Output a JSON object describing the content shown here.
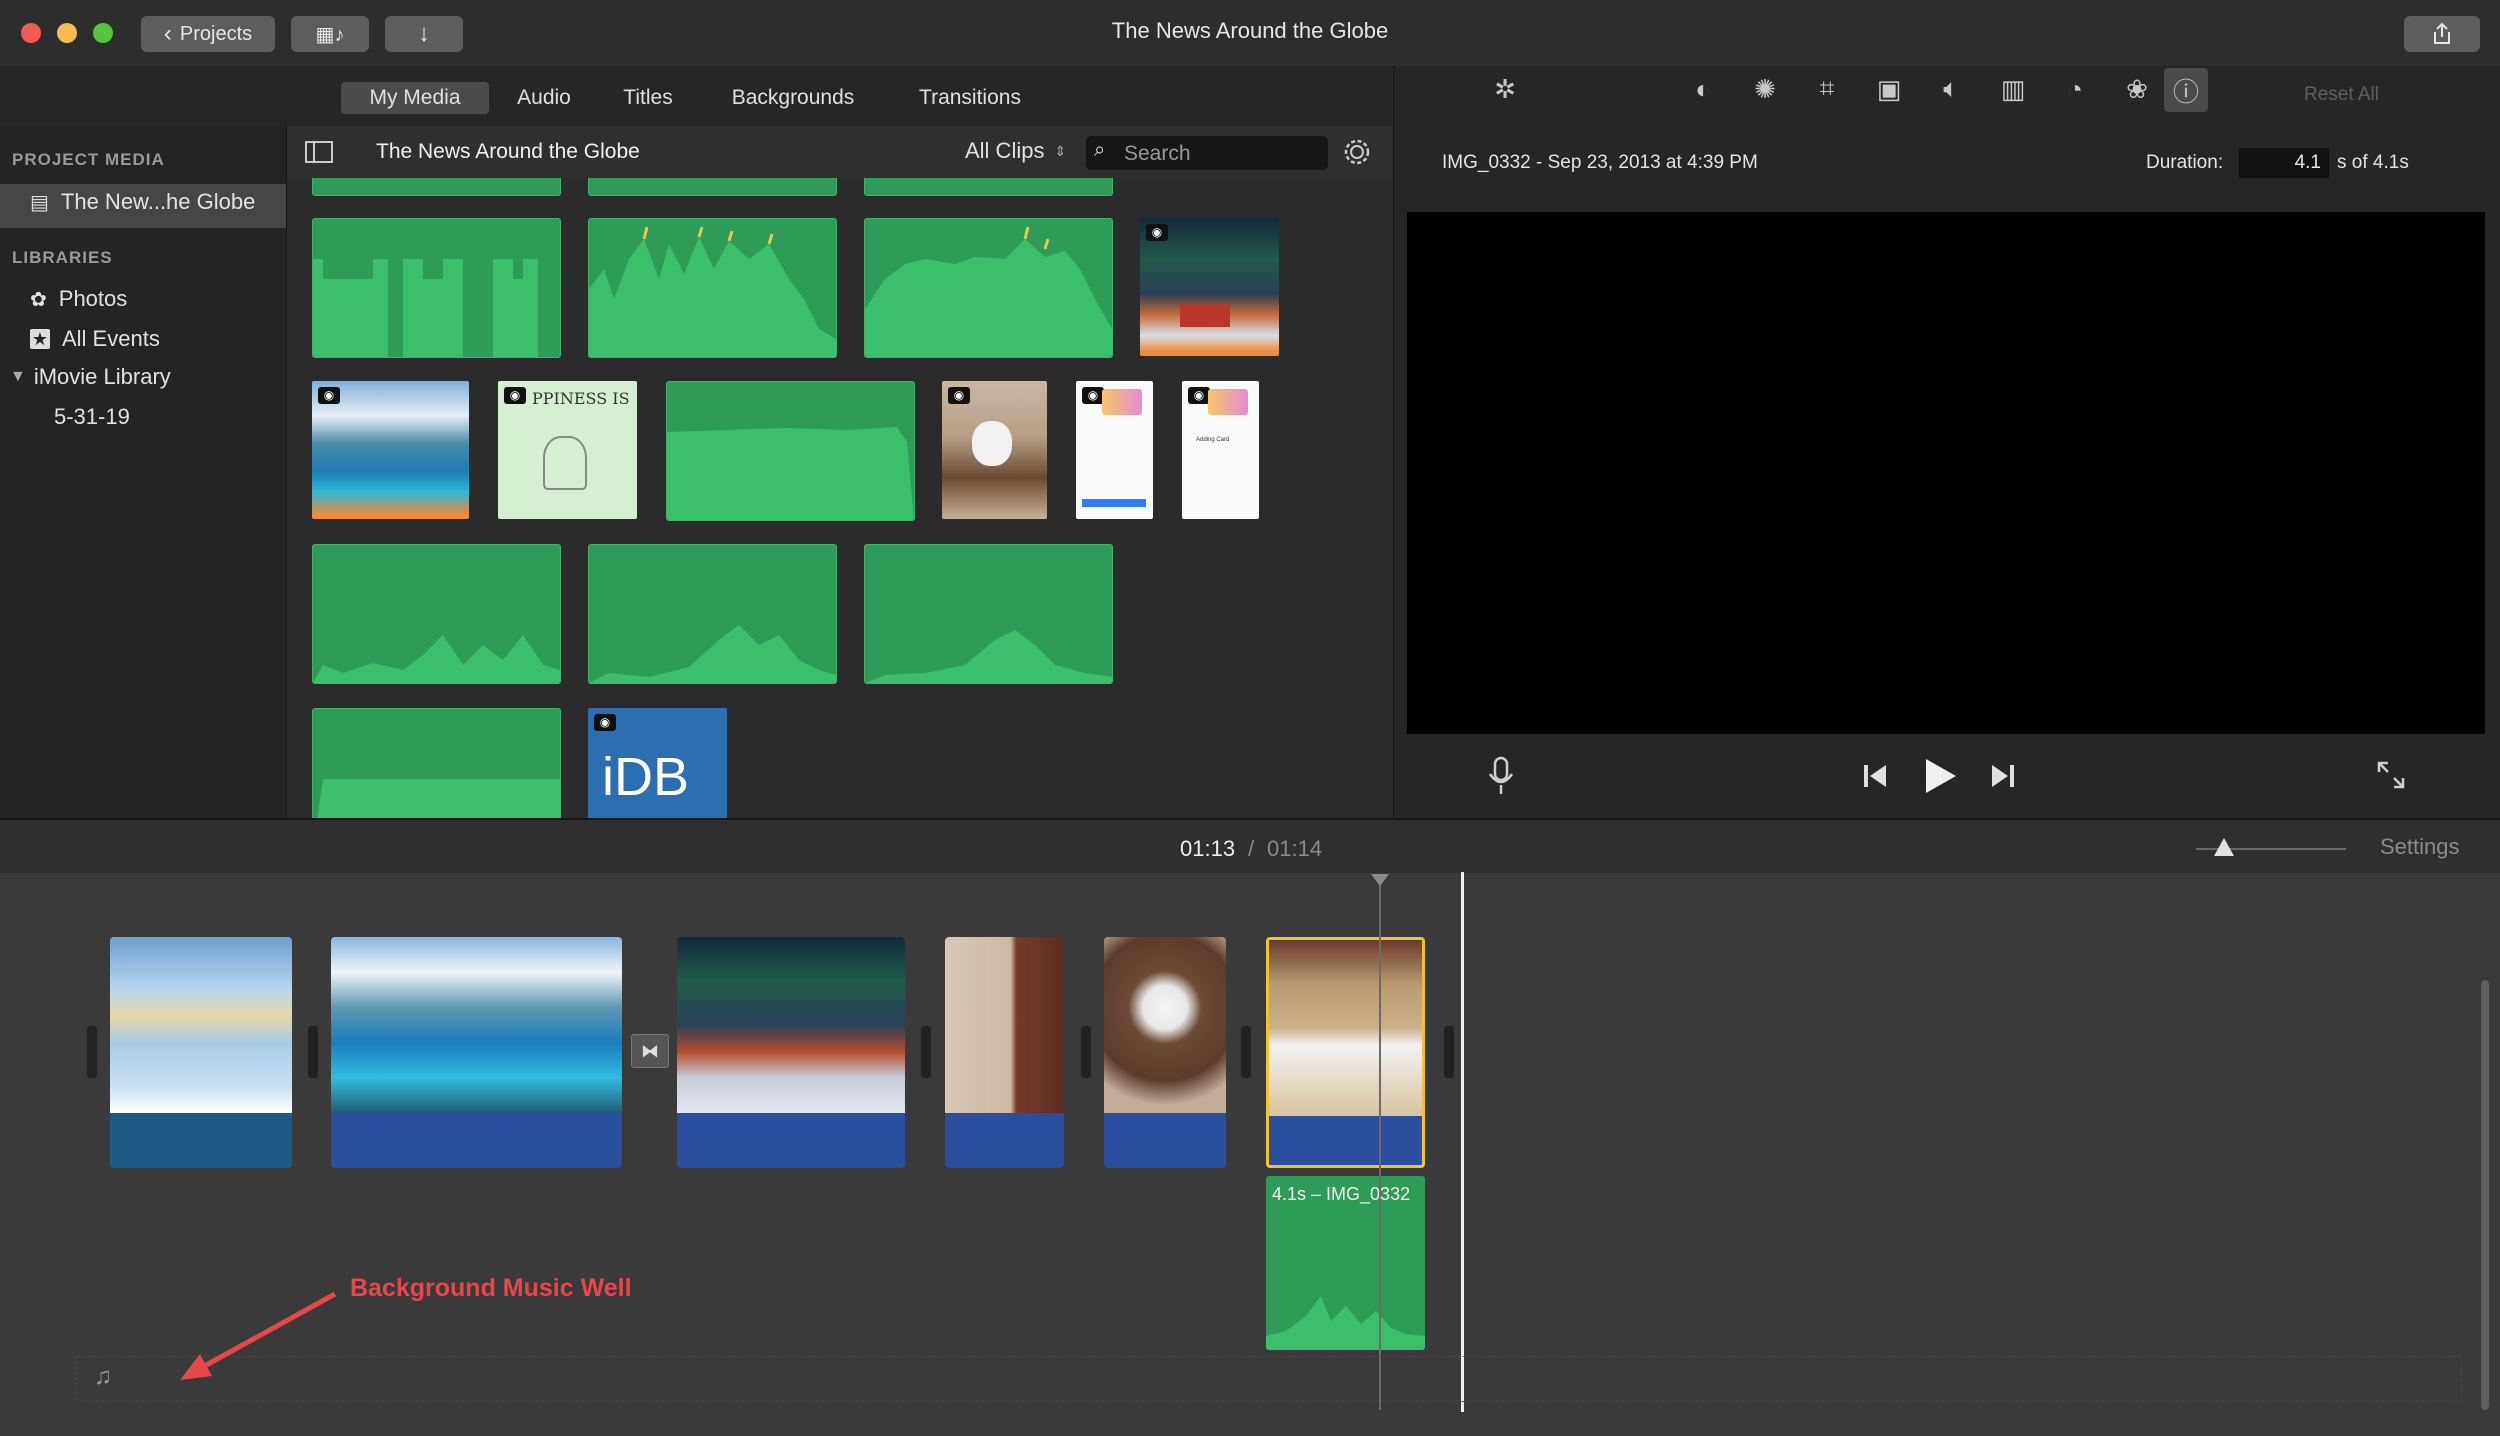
{
  "window": {
    "title": "The News Around the Globe",
    "projects_button": "Projects",
    "colors": {
      "close": "#ee5c55",
      "minimize": "#f3be4f",
      "maximize": "#58c33e"
    }
  },
  "browser_tabs": [
    {
      "label": "My Media",
      "active": true
    },
    {
      "label": "Audio"
    },
    {
      "label": "Titles"
    },
    {
      "label": "Backgrounds"
    },
    {
      "label": "Transitions"
    }
  ],
  "sidebar": {
    "project_media_header": "PROJECT MEDIA",
    "project_item": "The New...he Globe",
    "libraries_header": "LIBRARIES",
    "libraries": [
      {
        "label": "Photos",
        "icon": "photos-icon"
      },
      {
        "label": "All Events",
        "icon": "star-icon"
      },
      {
        "label": "iMovie Library",
        "icon": "disclosure-triangle-icon"
      },
      {
        "label": "5-31-19"
      }
    ]
  },
  "browser": {
    "title": "The News Around the Globe",
    "filter": "All Clips",
    "search_placeholder": "Search",
    "thumb_texts": {
      "happiness": "PPINESS IS",
      "idb": "iDB",
      "card1": "Adding Card"
    }
  },
  "viewer": {
    "clip_info": "IMG_0332 - Sep 23, 2013 at 4:39 PM",
    "duration_label": "Duration:",
    "duration_value": "4.1",
    "duration_suffix": "s of 4.1s",
    "reset_all": "Reset All"
  },
  "timeline": {
    "current_time": "01:13",
    "separator": "/",
    "total_time": "01:14",
    "settings": "Settings",
    "selected_clip_label": "4.1s – IMG_0332",
    "annotation": "Background Music Well"
  },
  "colors": {
    "audio_green": "#2e9b58",
    "clip_blue": "#2b4f9e",
    "selection": "#f1c232",
    "annotation": "#e8474a"
  }
}
